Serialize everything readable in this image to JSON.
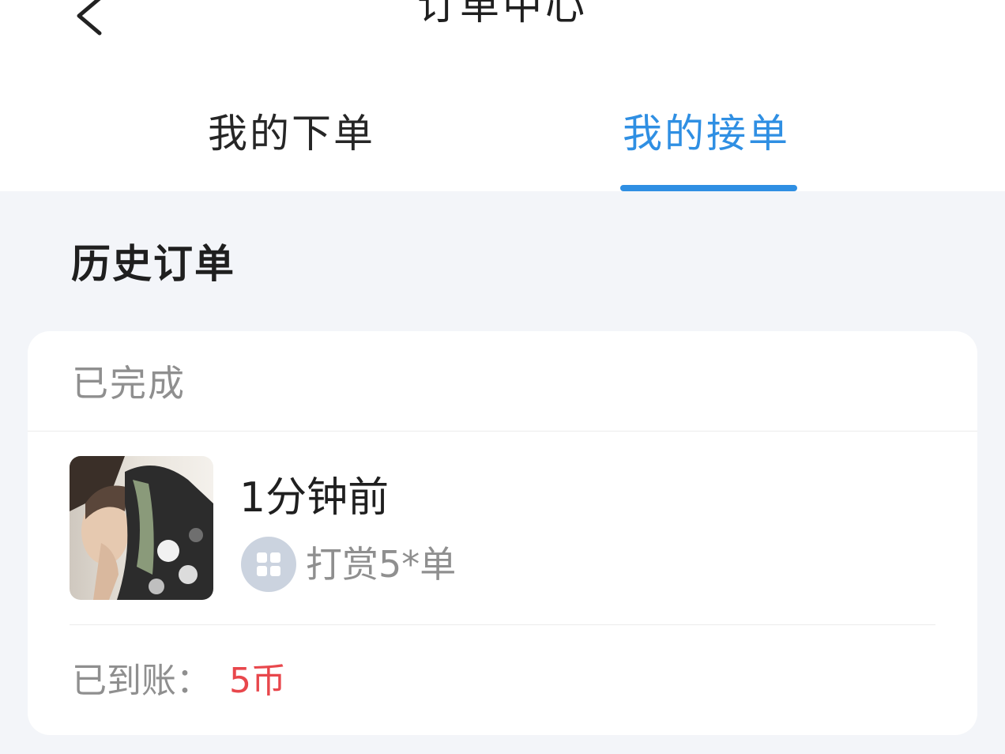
{
  "header": {
    "title": "订单中心",
    "back_icon": "chevron-left-icon"
  },
  "tabs": [
    {
      "label": "我的下单",
      "active": false
    },
    {
      "label": "我的接单",
      "active": true
    }
  ],
  "colors": {
    "accent": "#2f8fe3",
    "amount": "#e8474c",
    "background": "#f3f5f9"
  },
  "section": {
    "title": "历史订单"
  },
  "order": {
    "status": "已完成",
    "time": "1分钟前",
    "type_icon": "game-grid-icon",
    "type": "打赏5*单",
    "received_label": "已到账：",
    "received_value": "5币"
  }
}
